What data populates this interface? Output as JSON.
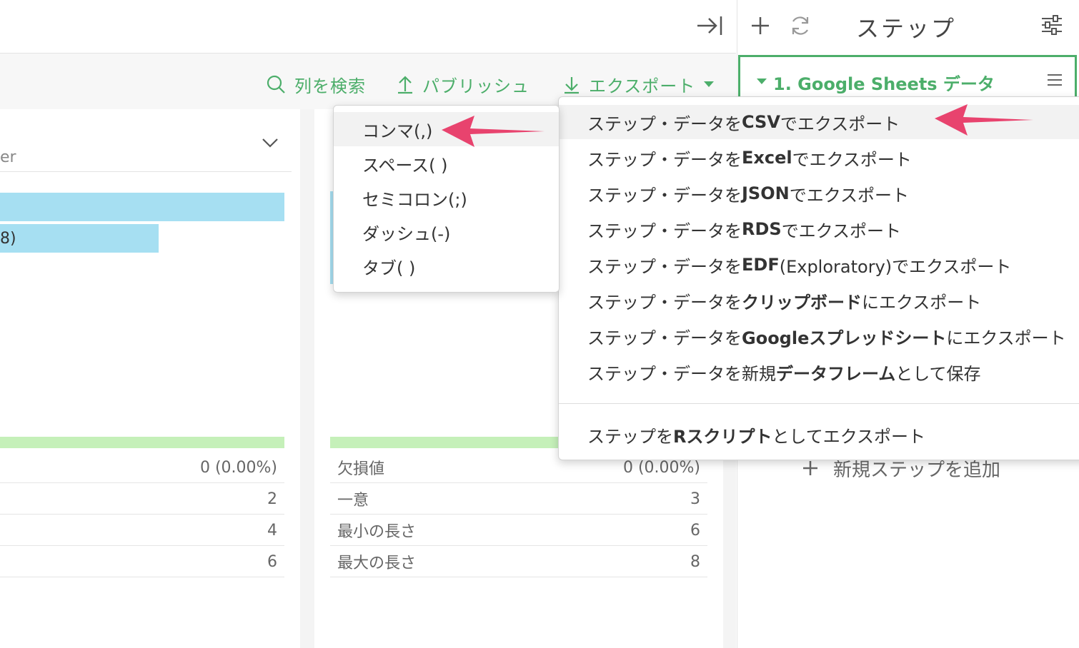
{
  "header": {
    "steps_title": "ステップ"
  },
  "toolbar": {
    "search_label": "列を検索",
    "publish_label": "パブリッシュ",
    "export_label": "エクスポート"
  },
  "left_card": {
    "header_fragment": "er",
    "bar_label_fragment": "8)",
    "stats": [
      {
        "value": "0 (0.00%)"
      },
      {
        "value": "2"
      },
      {
        "value": "4"
      },
      {
        "value": "6"
      }
    ]
  },
  "mid_card": {
    "stats": [
      {
        "label": "欠損値",
        "value": "0 (0.00%)"
      },
      {
        "label": "一意",
        "value": "3"
      },
      {
        "label": "最小の長さ",
        "value": "6"
      },
      {
        "label": "最大の長さ",
        "value": "8"
      }
    ]
  },
  "step": {
    "name": "1. Google Sheets データ",
    "add_step_label": "新規ステップを追加"
  },
  "delimiter_menu": {
    "items": [
      "コンマ(,)",
      "スペース( )",
      "セミコロン(;)",
      "ダッシュ(-)",
      "タブ( )"
    ]
  },
  "export_menu": {
    "items": [
      {
        "pre": "ステップ・データを",
        "bold": "CSV",
        "post": "でエクスポート"
      },
      {
        "pre": "ステップ・データを",
        "bold": "Excel",
        "post": "でエクスポート"
      },
      {
        "pre": "ステップ・データを",
        "bold": "JSON",
        "post": "でエクスポート"
      },
      {
        "pre": "ステップ・データを",
        "bold": "RDS",
        "post": "でエクスポート"
      },
      {
        "pre": "ステップ・データを",
        "bold": "EDF",
        "post": " (Exploratory)でエクスポート"
      },
      {
        "pre": "ステップ・データを",
        "bold": "クリップボード",
        "post": "にエクスポート"
      },
      {
        "pre": "ステップ・データを",
        "bold": "Googleスプレッドシート",
        "post": "にエクスポート"
      },
      {
        "pre": "ステップ・データを新規",
        "bold": "データフレーム",
        "post": "として保存"
      },
      {
        "pre": "ステップを",
        "bold": "Rスクリプト",
        "post": "としてエクスポート"
      }
    ]
  },
  "colors": {
    "accent_green": "#4cae6a",
    "bar_blue": "#a6dff2",
    "bar_green": "#c5f0b9",
    "arrow_pink": "#e8436e"
  }
}
